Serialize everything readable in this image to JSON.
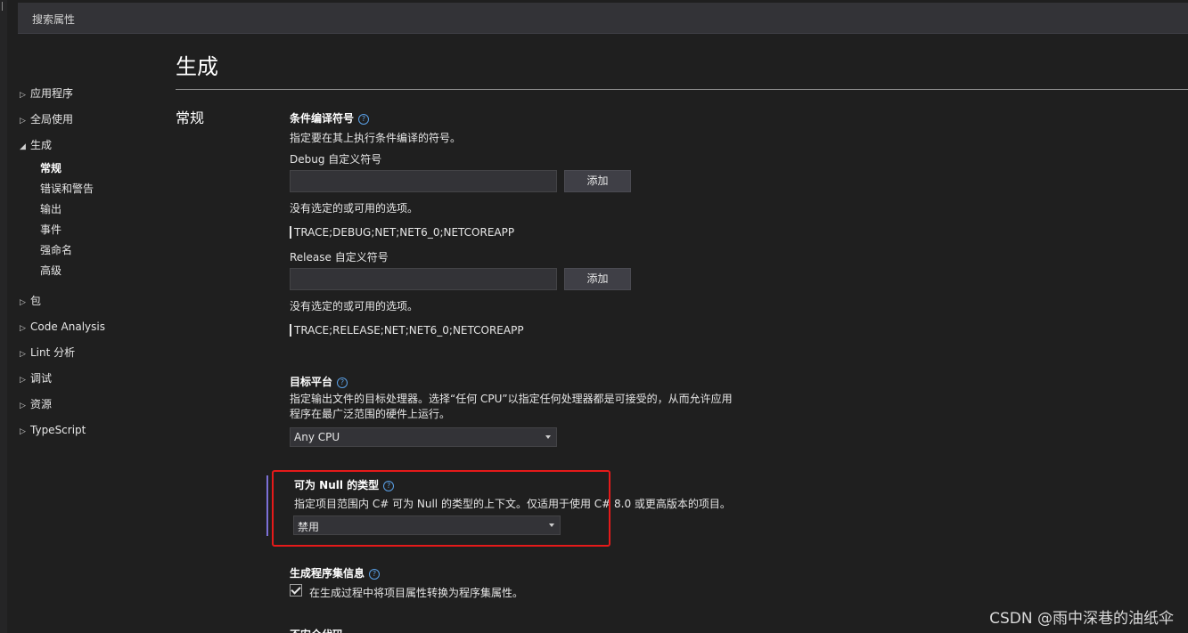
{
  "search": {
    "placeholder": "搜索属性"
  },
  "sidebar": {
    "items": [
      {
        "label": "应用程序",
        "expanded": false
      },
      {
        "label": "全局使用",
        "expanded": false
      },
      {
        "label": "生成",
        "expanded": true
      },
      {
        "label": "包",
        "expanded": false
      },
      {
        "label": "Code Analysis",
        "expanded": false
      },
      {
        "label": "Lint 分析",
        "expanded": false
      },
      {
        "label": "调试",
        "expanded": false
      },
      {
        "label": "资源",
        "expanded": false
      },
      {
        "label": "TypeScript",
        "expanded": false
      }
    ],
    "build_children": [
      {
        "label": "常规",
        "active": true
      },
      {
        "label": "错误和警告"
      },
      {
        "label": "输出"
      },
      {
        "label": "事件"
      },
      {
        "label": "强命名"
      },
      {
        "label": "高级"
      }
    ]
  },
  "page": {
    "title": "生成",
    "section": "常规"
  },
  "conditional": {
    "title": "条件编译符号",
    "desc": "指定要在其上执行条件编译的符号。",
    "debug_label": "Debug 自定义符号",
    "debug_add": "添加",
    "debug_none": "没有选定的或可用的选项。",
    "debug_symbols": "TRACE;DEBUG;NET;NET6_0;NETCOREAPP",
    "release_label": "Release 自定义符号",
    "release_add": "添加",
    "release_none": "没有选定的或可用的选项。",
    "release_symbols": "TRACE;RELEASE;NET;NET6_0;NETCOREAPP"
  },
  "platform": {
    "title": "目标平台",
    "desc_line1": "指定输出文件的目标处理器。选择“任何 CPU”以指定任何处理器都是可接受的，从而允许应用",
    "desc_line2": "程序在最广泛范围的硬件上运行。",
    "value": "Any CPU"
  },
  "nullable": {
    "title": "可为 Null 的类型",
    "desc": "指定项目范围内 C# 可为 Null 的类型的上下文。仅适用于使用 C# 8.0 或更高版本的项目。",
    "value": "禁用"
  },
  "assembly": {
    "title": "生成程序集信息",
    "checkbox_label": "在生成过程中将项目属性转换为程序集属性。",
    "checked": true
  },
  "next_section_partial": "不安全代码",
  "help_glyph": "?",
  "watermark": "CSDN @雨中深巷的油纸伞",
  "colors": {
    "accent_purple": "#7c70d6",
    "highlight_red": "#e51a1a",
    "help_blue": "#5aa0e6"
  }
}
